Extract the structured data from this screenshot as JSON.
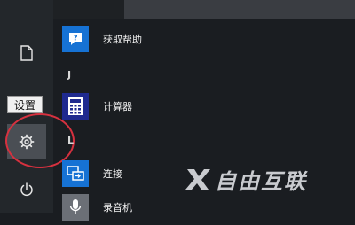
{
  "rail": {
    "tooltip": "设置",
    "items": [
      {
        "icon": "document-icon"
      },
      {
        "icon": "gear-icon"
      },
      {
        "icon": "power-icon"
      }
    ]
  },
  "app_list": {
    "apps": [
      {
        "label": "获取帮助",
        "icon": "help-icon",
        "tile_color": "#1672d4"
      },
      {
        "label": "计算器",
        "icon": "calculator-icon",
        "tile_color": "#1f2a8f"
      },
      {
        "label": "连接",
        "icon": "connect-icon",
        "tile_color": "#1672d4"
      },
      {
        "label": "录音机",
        "icon": "recorder-icon",
        "tile_color": "#6b6f76"
      }
    ],
    "letters": [
      "J",
      "L"
    ]
  },
  "watermark": {
    "text": "自由互联"
  },
  "colors": {
    "accent_blue": "#1672d4",
    "highlight_circle": "#d6313f"
  }
}
